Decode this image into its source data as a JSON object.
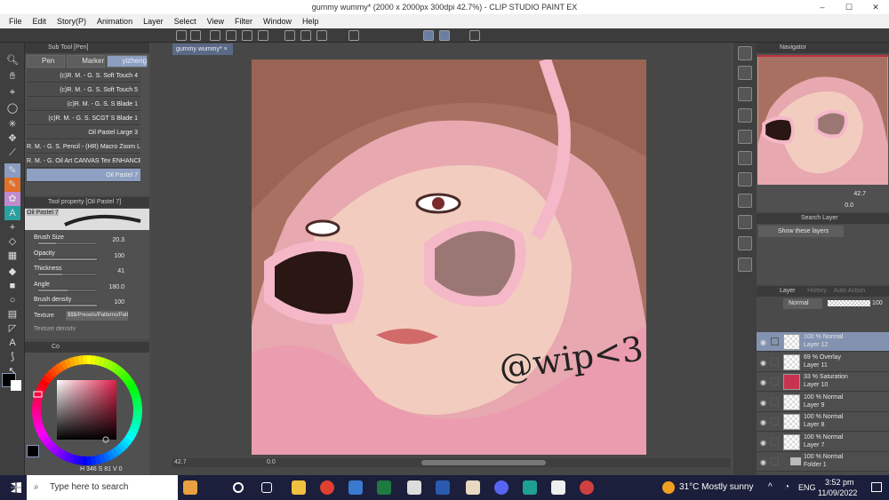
{
  "window": {
    "title": "gummy wummy* (2000 x 2000px 300dpi 42.7%) - CLIP STUDIO PAINT EX"
  },
  "menu": [
    "File",
    "Edit",
    "Story(P)",
    "Animation",
    "Layer",
    "Select",
    "View",
    "Filter",
    "Window",
    "Help"
  ],
  "subtool": {
    "title": "Sub Tool [Pen]",
    "tabs": [
      "Pen",
      "Marker",
      "yizheng"
    ],
    "brushes": [
      "(c)R. M. - G. S. Soft Touch 4",
      "(c)R. M. - G. S. Soft Touch 5",
      "(c)R. M. - G. S. S Blade 1",
      "(c)R. M. - G. S. SCGT S Blade 1",
      "Oil Pastel Large 3",
      "R. M. - G. S. Pencil - (HR) Macro Zoom Le",
      "R. M. - G. Oil Art CANVAS Tex ENHANCE",
      "Oil Pastel 7"
    ],
    "selected": "Oil Pastel 7"
  },
  "tool_property": {
    "title": "Tool property [Oil Pastel 7]",
    "brush_name": "Oil Pastel 7",
    "props": [
      {
        "label": "Brush Size",
        "value": "20.3",
        "fill": 0.3
      },
      {
        "label": "Opacity",
        "value": "100",
        "fill": 1.0
      },
      {
        "label": "Thickness",
        "value": "41",
        "fill": 0.41
      },
      {
        "label": "Angle",
        "value": "180.0",
        "fill": 0.5
      },
      {
        "label": "Brush density",
        "value": "100",
        "fill": 1.0
      }
    ],
    "texture_label": "Texture",
    "texture_value": "$$$/Presets/Patterns/Patt",
    "cut_label": "Texture density"
  },
  "color": {
    "tab": "Co",
    "h": "346",
    "s": "81",
    "v": "0",
    "main": "#000000",
    "sub": "#ffffff",
    "accent": "#c8294a"
  },
  "canvas": {
    "doc_tab": "gummy wummy*",
    "signature": "@wip<3",
    "zoom": "42.7",
    "angle": "0.0"
  },
  "navigator": {
    "title": "Navigator",
    "zoom": "42.7",
    "angle": "0.0"
  },
  "search_layer": {
    "title": "Search Layer",
    "filter": "Show these layers"
  },
  "layer_panel": {
    "title": "Layer",
    "tabs": [
      "History",
      "Auto Action"
    ],
    "blend": "Normal",
    "opacity": "100",
    "layers": [
      {
        "mode": "100 % Normal",
        "name": "Layer 12",
        "selected": true,
        "thumb": "transparent"
      },
      {
        "mode": "69 % Overlay",
        "name": "Layer 11",
        "thumb": "transparent"
      },
      {
        "mode": "33 % Saturation",
        "name": "Layer 10",
        "thumb": "#c8334f"
      },
      {
        "mode": "100 % Normal",
        "name": "Layer 9",
        "thumb": "sketch"
      },
      {
        "mode": "100 % Normal",
        "name": "Layer 8",
        "thumb": "sketch"
      },
      {
        "mode": "100 % Normal",
        "name": "Layer 7",
        "thumb": "transparent"
      },
      {
        "mode": "100 % Normal",
        "name": "Folder 1",
        "folder": true
      }
    ]
  },
  "taskbar": {
    "search_placeholder": "Type here to search",
    "weather": "31°C  Mostly sunny",
    "lang": "ENG",
    "time": "3:52 pm",
    "date": "11/09/2022"
  }
}
